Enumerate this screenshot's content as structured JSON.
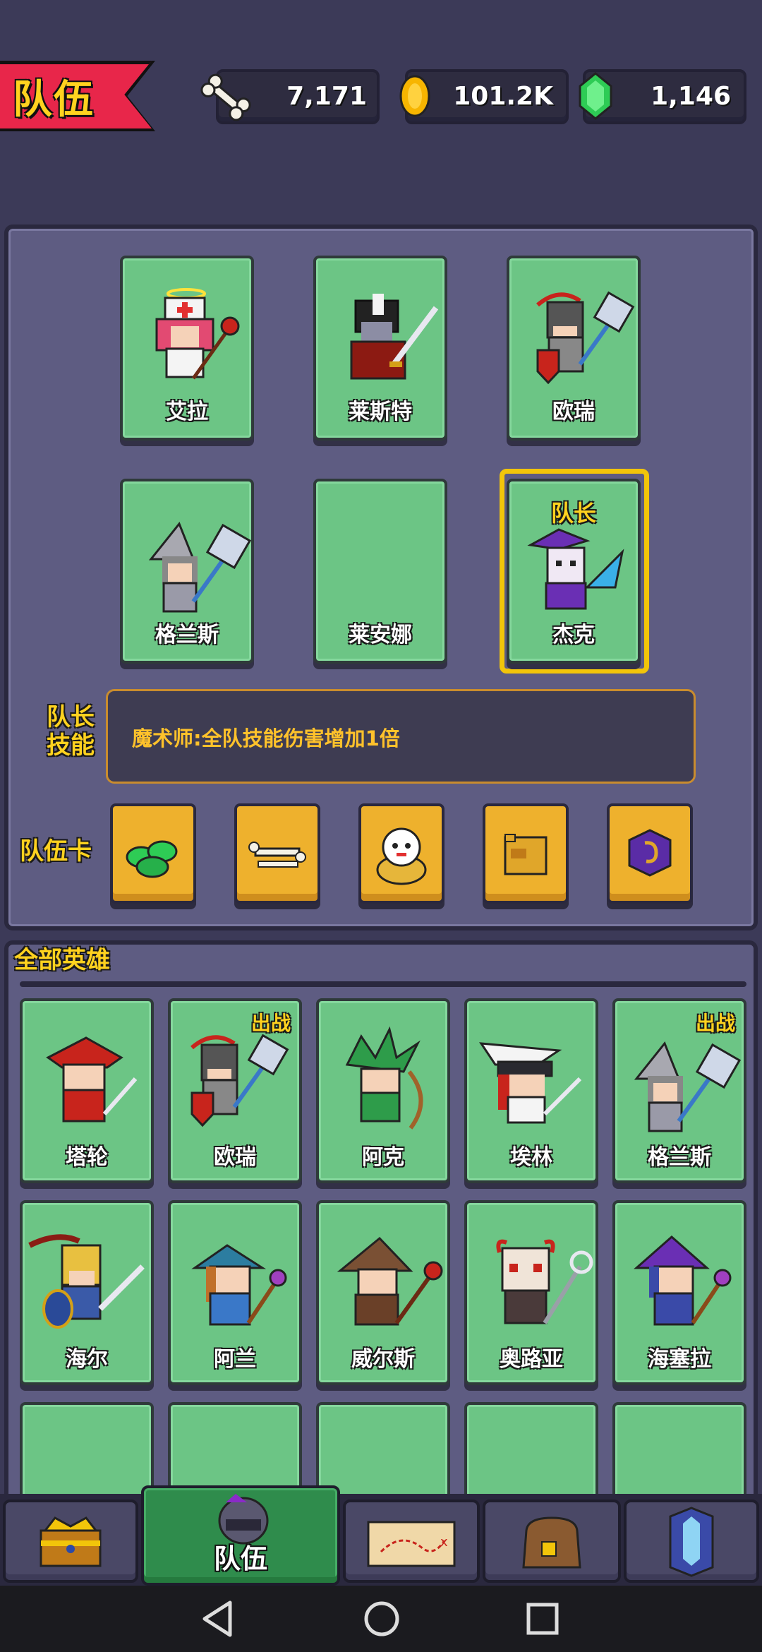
{
  "header": {
    "title": "队伍",
    "resources": [
      {
        "name": "bone",
        "icon": "bone-icon",
        "value": "7,171"
      },
      {
        "name": "gold",
        "icon": "gold-coin-icon",
        "value": "101.2K"
      },
      {
        "name": "gem",
        "icon": "green-gem-icon",
        "value": "1,146"
      }
    ]
  },
  "team": {
    "slots": [
      {
        "name": "艾拉"
      },
      {
        "name": "莱斯特"
      },
      {
        "name": "欧瑞"
      },
      {
        "name": "格兰斯"
      },
      {
        "name": "莱安娜"
      },
      {
        "name": "杰克",
        "captain_label": "队长"
      }
    ],
    "leader_skill_label": "队长\n技能",
    "leader_skill_label_line1": "队长",
    "leader_skill_label_line2": "技能",
    "leader_skill_text": "魔术师:全队技能伤害增加1倍",
    "team_cards_label": "队伍卡",
    "team_cards": [
      {
        "icon": "green-gems-pile-icon"
      },
      {
        "icon": "bones-pile-icon"
      },
      {
        "icon": "lucky-cat-icon"
      },
      {
        "icon": "golden-pig-icon"
      },
      {
        "icon": "purple-coin-icon"
      }
    ]
  },
  "heroes": {
    "title": "全部英雄",
    "deployed_tag": "出战",
    "list": [
      {
        "name": "塔轮",
        "deployed": false
      },
      {
        "name": "欧瑞",
        "deployed": true
      },
      {
        "name": "阿克",
        "deployed": false
      },
      {
        "name": "埃林",
        "deployed": false
      },
      {
        "name": "格兰斯",
        "deployed": true
      },
      {
        "name": "海尔",
        "deployed": false
      },
      {
        "name": "阿兰",
        "deployed": false
      },
      {
        "name": "威尔斯",
        "deployed": false
      },
      {
        "name": "奥路亚",
        "deployed": false
      },
      {
        "name": "海塞拉",
        "deployed": false
      }
    ]
  },
  "nav": {
    "items": [
      {
        "icon": "treasure-chest-icon",
        "label": ""
      },
      {
        "icon": "helmet-icon",
        "label": "队伍",
        "active": true
      },
      {
        "icon": "treasure-map-icon",
        "label": ""
      },
      {
        "icon": "backpack-icon",
        "label": ""
      },
      {
        "icon": "crystal-tower-icon",
        "label": ""
      }
    ]
  },
  "colors": {
    "background": "#3c3a58",
    "panel": "#5e5c82",
    "slot_green": "#6cc585",
    "accent_yellow": "#ffd21f",
    "banner_red": "#e8264a",
    "card_gold": "#eeb12d"
  }
}
